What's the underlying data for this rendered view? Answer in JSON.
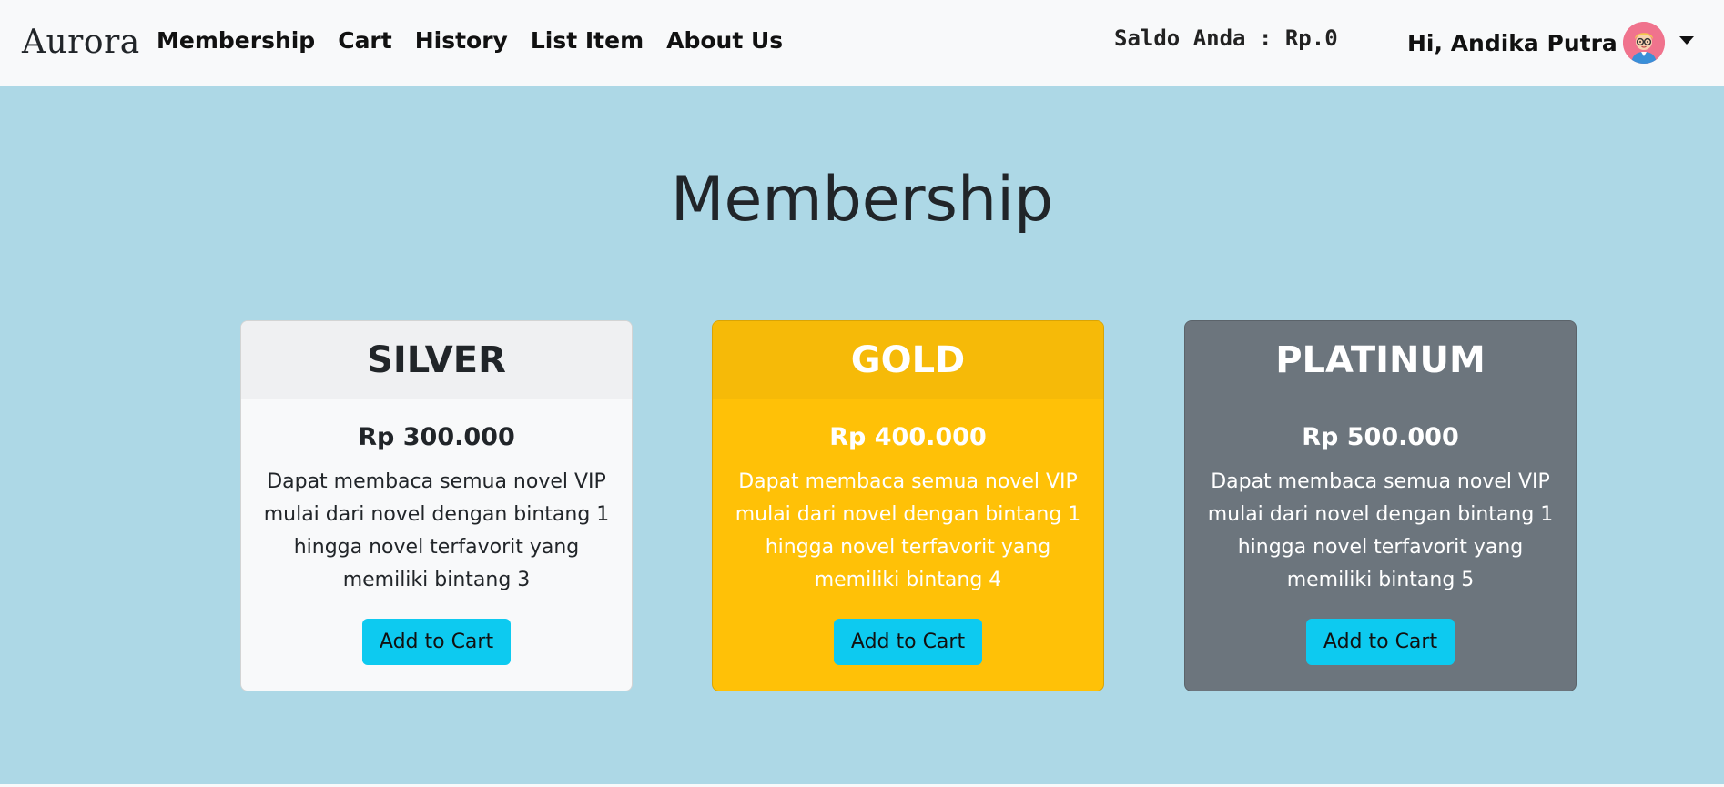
{
  "navbar": {
    "brand": "Aurora",
    "links": [
      "Membership",
      "Cart",
      "History",
      "List Item",
      "About Us"
    ],
    "saldo": "Saldo Anda : Rp.0",
    "greeting": "Hi, Andika Putra",
    "avatar_icon": "user-avatar-icon"
  },
  "main": {
    "title": "Membership",
    "plans": [
      {
        "name": "SILVER",
        "price": "Rp 300.000",
        "description": "Dapat membaca semua novel VIP mulai dari novel dengan bintang 1 hingga novel terfavorit yang memiliki bintang 3",
        "button": "Add to Cart",
        "color": "#f8f9fa"
      },
      {
        "name": "GOLD",
        "price": "Rp 400.000",
        "description": "Dapat membaca semua novel VIP mulai dari novel dengan bintang 1 hingga novel terfavorit yang memiliki bintang 4",
        "button": "Add to Cart",
        "color": "#ffc107"
      },
      {
        "name": "PLATINUM",
        "price": "Rp 500.000",
        "description": "Dapat membaca semua novel VIP mulai dari novel dengan bintang 1 hingga novel terfavorit yang memiliki bintang 5",
        "button": "Add to Cart",
        "color": "#6c757d"
      }
    ]
  },
  "colors": {
    "background": "#add8e6",
    "navbar": "#f8f9fa",
    "button": "#0dcaf0"
  }
}
